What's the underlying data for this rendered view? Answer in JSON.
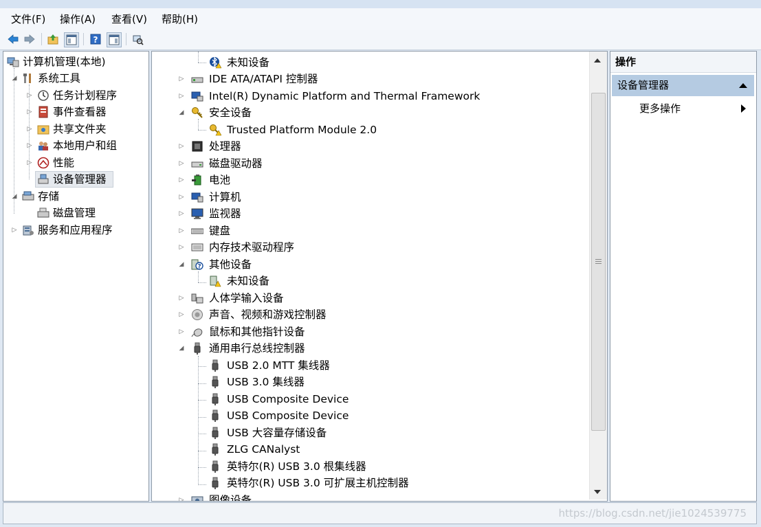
{
  "menu": [
    "文件(F)",
    "操作(A)",
    "查看(V)",
    "帮助(H)"
  ],
  "toolbar_icons": [
    "back-arrow-icon",
    "forward-arrow-icon",
    "up-folder-icon",
    "show-hide-console-tree-icon",
    "help-icon",
    "properties-icon",
    "scan-hardware-icon"
  ],
  "left_tree": {
    "root": "计算机管理(本地)",
    "system_tools": "系统工具",
    "task_scheduler": "任务计划程序",
    "event_viewer": "事件查看器",
    "shared_folders": "共享文件夹",
    "local_users": "本地用户和组",
    "performance": "性能",
    "device_manager": "设备管理器",
    "storage": "存储",
    "disk_management": "磁盘管理",
    "services_apps": "服务和应用程序"
  },
  "devices": [
    {
      "label": "未知设备"
    },
    {
      "label": "IDE ATA/ATAPI 控制器"
    },
    {
      "label": "Intel(R) Dynamic Platform and Thermal Framework"
    },
    {
      "label": "安全设备"
    },
    {
      "label": "Trusted Platform Module 2.0"
    },
    {
      "label": "处理器"
    },
    {
      "label": "磁盘驱动器"
    },
    {
      "label": "电池"
    },
    {
      "label": "计算机"
    },
    {
      "label": "监视器"
    },
    {
      "label": "键盘"
    },
    {
      "label": "内存技术驱动程序"
    },
    {
      "label": "其他设备"
    },
    {
      "label": "未知设备"
    },
    {
      "label": "人体学输入设备"
    },
    {
      "label": "声音、视频和游戏控制器"
    },
    {
      "label": "鼠标和其他指针设备"
    },
    {
      "label": "通用串行总线控制器"
    },
    {
      "label": "USB 2.0 MTT 集线器"
    },
    {
      "label": "USB 3.0 集线器"
    },
    {
      "label": "USB Composite Device"
    },
    {
      "label": "USB Composite Device"
    },
    {
      "label": "USB 大容量存储设备"
    },
    {
      "label": "ZLG CANalyst"
    },
    {
      "label": "英特尔(R) USB 3.0 根集线器"
    },
    {
      "label": "英特尔(R) USB 3.0 可扩展主机控制器"
    },
    {
      "label": "图像设备"
    }
  ],
  "actions": {
    "header": "操作",
    "section": "设备管理器",
    "more": "更多操作"
  },
  "watermark": "https://blog.csdn.net/jie1024539775"
}
